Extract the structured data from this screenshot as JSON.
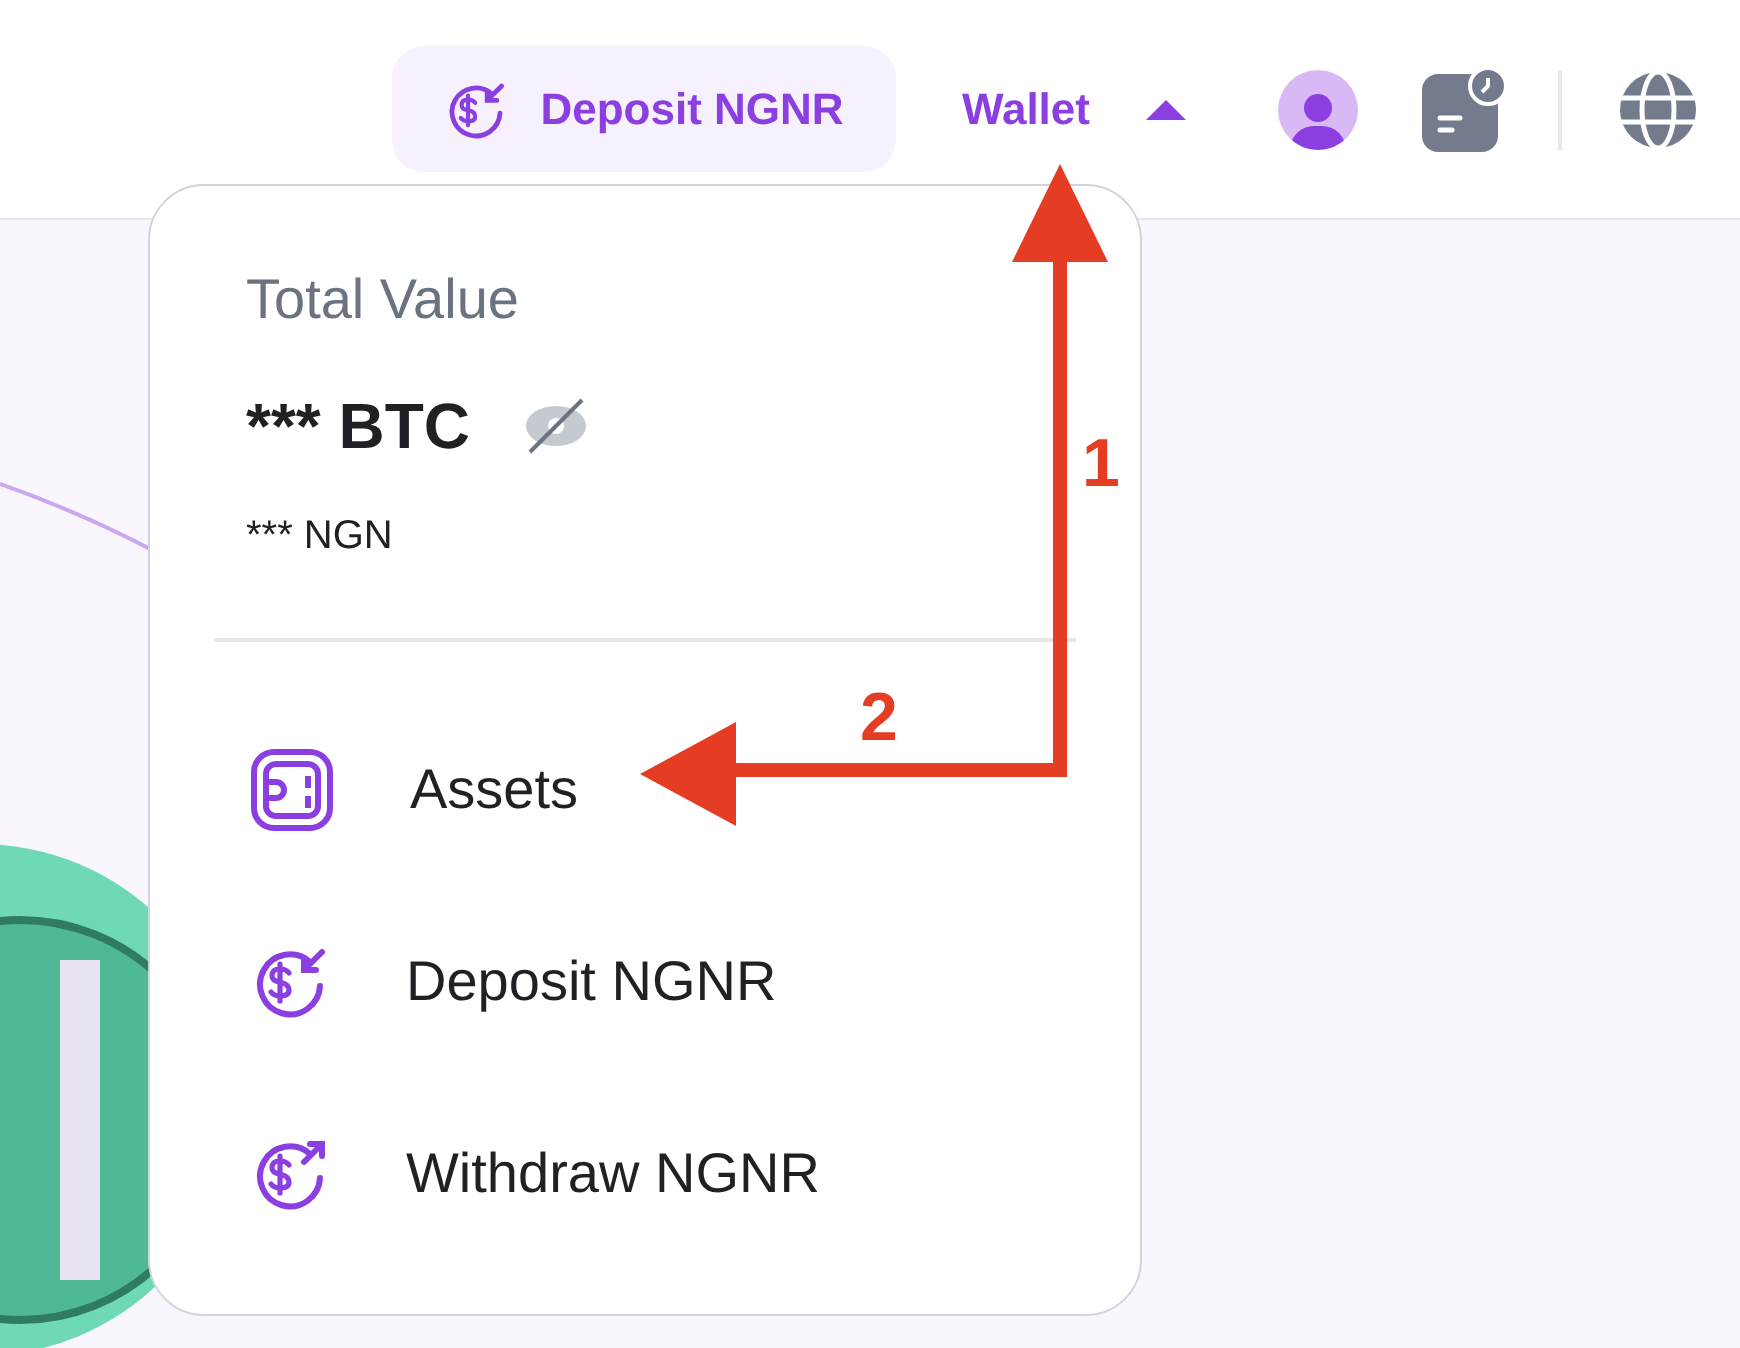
{
  "header": {
    "deposit_button": {
      "label": "Deposit NGNR"
    },
    "wallet_menu": {
      "label": "Wallet",
      "expanded": true
    }
  },
  "wallet_dropdown": {
    "title": "Total Value",
    "btc_value": "*** BTC",
    "ngn_value": "*** NGN",
    "hidden": true,
    "items": [
      {
        "kind": "assets",
        "label": "Assets"
      },
      {
        "kind": "deposit",
        "label": "Deposit NGNR"
      },
      {
        "kind": "withdraw",
        "label": "Withdraw NGNR"
      }
    ]
  },
  "annotations": [
    {
      "label": "1"
    },
    {
      "label": "2"
    }
  ]
}
